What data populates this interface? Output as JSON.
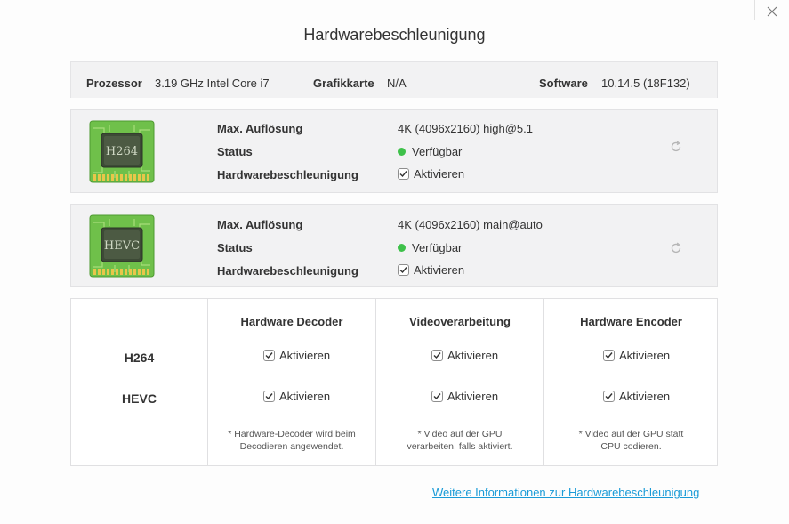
{
  "window": {
    "title": "Hardwarebeschleunigung",
    "close_icon": "close-icon"
  },
  "system": {
    "processor_label": "Prozessor",
    "processor_value": "3.19 GHz Intel Core i7",
    "gpu_label": "Grafikkarte",
    "gpu_value": "N/A",
    "software_label": "Software",
    "software_value": "10.14.5 (18F132)"
  },
  "codecs": [
    {
      "chip_label": "H264",
      "resolution_label": "Max. Auflösung",
      "resolution_value": "4K (4096x2160) high@5.1",
      "status_label": "Status",
      "status_value": "Verfügbar",
      "hwaccel_label": "Hardwarebeschleunigung",
      "hwaccel_value": "Aktivieren",
      "hwaccel_checked": true
    },
    {
      "chip_label": "HEVC",
      "resolution_label": "Max. Auflösung",
      "resolution_value": "4K (4096x2160) main@auto",
      "status_label": "Status",
      "status_value": "Verfügbar",
      "hwaccel_label": "Hardwarebeschleunigung",
      "hwaccel_value": "Aktivieren",
      "hwaccel_checked": true
    }
  ],
  "matrix": {
    "columns": [
      "Hardware Decoder",
      "Videoverarbeitung",
      "Hardware Encoder"
    ],
    "rows": [
      {
        "name": "H264",
        "cells": [
          "Aktivieren",
          "Aktivieren",
          "Aktivieren"
        ],
        "checked": [
          true,
          true,
          true
        ]
      },
      {
        "name": "HEVC",
        "cells": [
          "Aktivieren",
          "Aktivieren",
          "Aktivieren"
        ],
        "checked": [
          true,
          true,
          true
        ]
      }
    ],
    "notes": [
      [
        "* Hardware-Decoder wird beim",
        "Decodieren angewendet."
      ],
      [
        "* Video auf der GPU",
        "verarbeiten, falls aktiviert."
      ],
      [
        "* Video auf der GPU statt",
        "CPU codieren."
      ]
    ]
  },
  "footer": {
    "link_text": "Weitere Informationen zur Hardwarebeschleunigung"
  },
  "colors": {
    "status_available": "#3ec14a",
    "link": "#1a9bd7",
    "chip_board": "#6fc04a",
    "chip_core": "#3d4a36"
  }
}
